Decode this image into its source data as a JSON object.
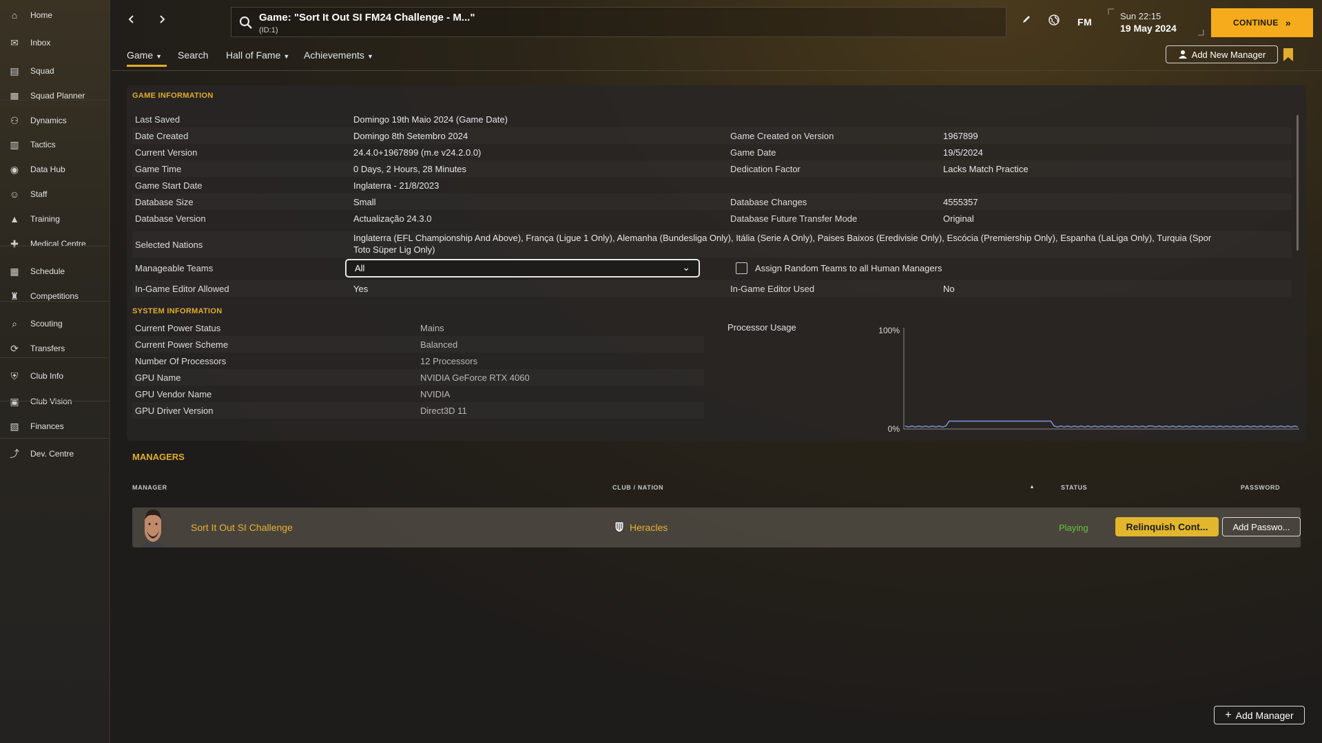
{
  "sidebar": {
    "items": [
      {
        "label": "Home",
        "icon": "home-icon"
      },
      {
        "label": "Inbox",
        "icon": "inbox-icon"
      },
      {
        "label": "Squad",
        "icon": "squad-icon"
      },
      {
        "label": "Squad Planner",
        "icon": "squad-planner-icon"
      },
      {
        "label": "Dynamics",
        "icon": "dynamics-icon"
      },
      {
        "label": "Tactics",
        "icon": "tactics-icon"
      },
      {
        "label": "Data Hub",
        "icon": "data-hub-icon"
      },
      {
        "label": "Staff",
        "icon": "staff-icon"
      },
      {
        "label": "Training",
        "icon": "training-icon"
      },
      {
        "label": "Medical Centre",
        "icon": "medical-icon"
      },
      {
        "label": "Schedule",
        "icon": "schedule-icon"
      },
      {
        "label": "Competitions",
        "icon": "trophy-icon"
      },
      {
        "label": "Scouting",
        "icon": "scouting-icon"
      },
      {
        "label": "Transfers",
        "icon": "transfers-icon"
      },
      {
        "label": "Club Info",
        "icon": "club-info-icon"
      },
      {
        "label": "Club Vision",
        "icon": "club-vision-icon"
      },
      {
        "label": "Finances",
        "icon": "finances-icon"
      },
      {
        "label": "Dev. Centre",
        "icon": "dev-centre-icon"
      }
    ]
  },
  "header": {
    "title": "Game: \"Sort It Out SI FM24 Challenge - M...\"",
    "subtitle": "(ID:1)",
    "logo": "FM",
    "time": "Sun 22:15",
    "date": "19 May 2024",
    "continue_label": "CONTINUE"
  },
  "tabs": [
    {
      "label": "Game",
      "dropdown": true
    },
    {
      "label": "Search",
      "dropdown": false
    },
    {
      "label": "Hall of Fame",
      "dropdown": true
    },
    {
      "label": "Achievements",
      "dropdown": true
    }
  ],
  "add_new_manager_label": "Add New Manager",
  "game_info": {
    "title": "GAME INFORMATION",
    "rows": [
      {
        "label": "Last Saved",
        "value": "Domingo 19th Maio 2024 (Game Date)",
        "label2": "",
        "value2": ""
      },
      {
        "label": "Date Created",
        "value": "Domingo 8th Setembro 2024",
        "label2": "Game Created on Version",
        "value2": "1967899"
      },
      {
        "label": "Current Version",
        "value": "24.4.0+1967899 (m.e v24.2.0.0)",
        "label2": "Game Date",
        "value2": "19/5/2024"
      },
      {
        "label": "Game Time",
        "value": "0 Days, 2 Hours, 28 Minutes",
        "label2": "Dedication Factor",
        "value2": "Lacks Match Practice"
      },
      {
        "label": "Game Start Date",
        "value": "Inglaterra - 21/8/2023",
        "label2": "",
        "value2": ""
      },
      {
        "label": "Database Size",
        "value": "Small",
        "label2": "Database Changes",
        "value2": "4555357"
      },
      {
        "label": "Database Version",
        "value": "Actualização 24.3.0",
        "label2": "Database Future Transfer Mode",
        "value2": "Original"
      }
    ],
    "nations_label": "Selected Nations",
    "nations_line1": "Inglaterra (EFL Championship And Above), França (Ligue 1 Only), Alemanha (Bundesliga Only), Itália (Serie A Only), Paises Baixos (Eredivisie Only), Escócia (Premiership Only), Espanha (LaLiga Only), Turquia (Spor",
    "nations_line2": "Toto Süper Lig Only)",
    "manageable_label": "Manageable Teams",
    "manageable_value": "All",
    "assign_label": "Assign Random Teams to all Human Managers",
    "editor_allowed_label": "In-Game Editor Allowed",
    "editor_allowed_value": "Yes",
    "editor_used_label": "In-Game Editor Used",
    "editor_used_value": "No"
  },
  "system_info": {
    "title": "SYSTEM INFORMATION",
    "rows": [
      {
        "label": "Current Power Status",
        "value": "Mains"
      },
      {
        "label": "Current Power Scheme",
        "value": "Balanced"
      },
      {
        "label": "Number Of Processors",
        "value": "12 Processors"
      },
      {
        "label": "GPU Name",
        "value": "NVIDIA GeForce RTX 4060"
      },
      {
        "label": "GPU Vendor Name",
        "value": "NVIDIA"
      },
      {
        "label": "GPU Driver Version",
        "value": "Direct3D 11"
      }
    ],
    "processor_label": "Processor Usage"
  },
  "chart_data": {
    "type": "line",
    "title": "Processor Usage",
    "y_tick_labels": [
      "100%",
      "0%"
    ],
    "ylim": [
      0,
      100
    ],
    "series": [
      {
        "values": [
          3,
          2,
          3,
          2,
          3,
          2,
          3,
          2,
          3,
          2,
          3,
          2,
          3,
          8,
          8,
          8,
          8,
          8,
          8,
          8,
          8,
          8,
          8,
          8,
          8,
          8,
          8,
          8,
          8,
          8,
          8,
          8,
          8,
          8,
          8,
          8,
          8,
          8,
          8,
          8,
          8,
          8,
          8,
          8,
          3,
          2,
          3,
          2,
          3,
          2,
          3,
          2,
          3,
          2,
          3,
          2,
          3,
          2,
          3,
          2,
          3,
          2,
          3,
          2,
          3,
          2,
          3,
          2,
          3,
          2,
          3,
          2,
          3,
          3,
          2,
          3,
          2,
          3,
          2,
          3,
          2,
          3,
          2,
          3,
          2,
          3,
          2,
          3,
          2,
          3,
          2,
          3,
          2,
          3,
          2,
          3,
          2,
          3,
          2,
          3,
          2,
          3,
          2,
          3,
          2,
          3,
          2,
          3,
          2,
          3,
          2,
          3,
          2,
          3,
          2,
          3,
          2
        ],
        "color": "#7b8fd6"
      }
    ],
    "grid": false
  },
  "managers": {
    "title": "MANAGERS",
    "columns": {
      "manager": "MANAGER",
      "club": "CLUB / NATION",
      "status": "STATUS",
      "password": "PASSWORD"
    },
    "rows": [
      {
        "name": "Sort It Out SI Challenge",
        "club": "Heracles",
        "status": "Playing",
        "relinquish": "Relinquish Cont...",
        "password": "Add Passwo..."
      }
    ],
    "add_manager_label": "Add Manager"
  },
  "colors": {
    "accent": "#e0ad2e",
    "continue": "#f5ab1b",
    "status_playing": "#69c33b"
  }
}
